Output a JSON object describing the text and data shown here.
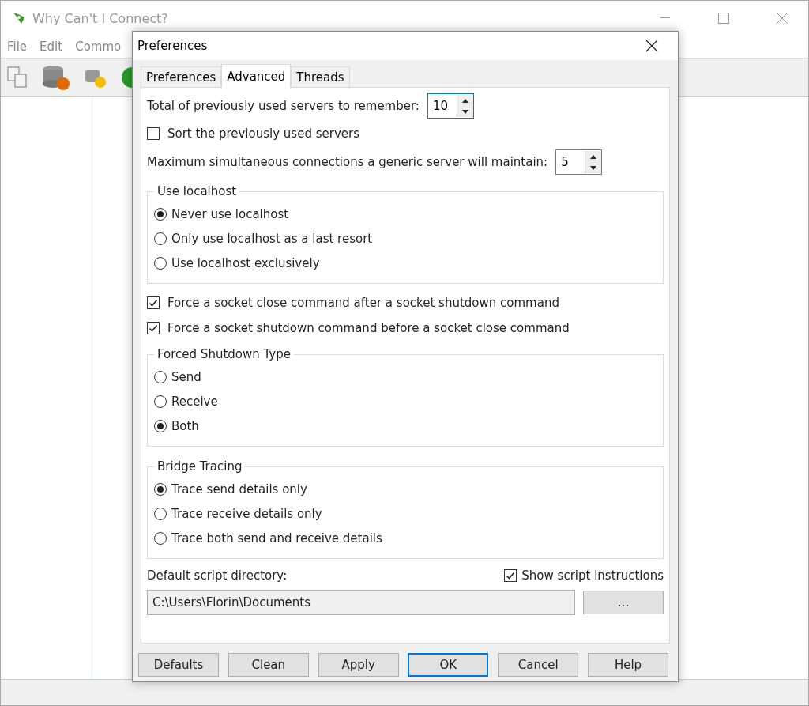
{
  "window": {
    "title": "Why Can't I Connect?"
  },
  "menu": [
    "File",
    "Edit",
    "Commo"
  ],
  "dialog": {
    "title": "Preferences",
    "tabs": [
      {
        "label": "Preferences",
        "selected": false
      },
      {
        "label": "Advanced",
        "selected": true
      },
      {
        "label": "Threads",
        "selected": false
      }
    ],
    "items": [
      {
        "kind": "spinner",
        "label": "Total of previously used servers to remember:",
        "value": "10",
        "focused": true
      },
      {
        "kind": "checkbox",
        "label": "Sort the previously used servers",
        "checked": false
      },
      {
        "kind": "spinner",
        "label": "Maximum simultaneous connections a generic server will maintain:",
        "value": "5",
        "focused": false
      },
      {
        "kind": "group",
        "title": "Use localhost",
        "options": [
          {
            "label": "Never use localhost",
            "selected": true
          },
          {
            "label": "Only use localhost as a last resort",
            "selected": false
          },
          {
            "label": "Use localhost exclusively",
            "selected": false
          }
        ]
      },
      {
        "kind": "checkbox",
        "label": "Force a socket close command after a socket shutdown command",
        "checked": true
      },
      {
        "kind": "checkbox",
        "label": "Force a socket shutdown command before a socket close command",
        "checked": true
      },
      {
        "kind": "group",
        "title": "Forced Shutdown Type",
        "options": [
          {
            "label": "Send",
            "selected": false
          },
          {
            "label": "Receive",
            "selected": false
          },
          {
            "label": "Both",
            "selected": true
          }
        ]
      },
      {
        "kind": "group",
        "title": "Bridge Tracing",
        "options": [
          {
            "label": "Trace send details only",
            "selected": true
          },
          {
            "label": "Trace receive details only",
            "selected": false
          },
          {
            "label": "Trace both send and receive details",
            "selected": false
          }
        ]
      }
    ],
    "script": {
      "label": "Default script directory:",
      "show_instructions": {
        "label": "Show script instructions",
        "checked": true
      },
      "path": "C:\\Users\\Florin\\Documents",
      "browse": "..."
    },
    "buttons": [
      {
        "label": "Defaults",
        "default": false
      },
      {
        "label": "Clean",
        "default": false
      },
      {
        "label": "Apply",
        "default": false
      },
      {
        "label": "OK",
        "default": true
      },
      {
        "label": "Cancel",
        "default": false
      },
      {
        "label": "Help",
        "default": false
      }
    ]
  }
}
